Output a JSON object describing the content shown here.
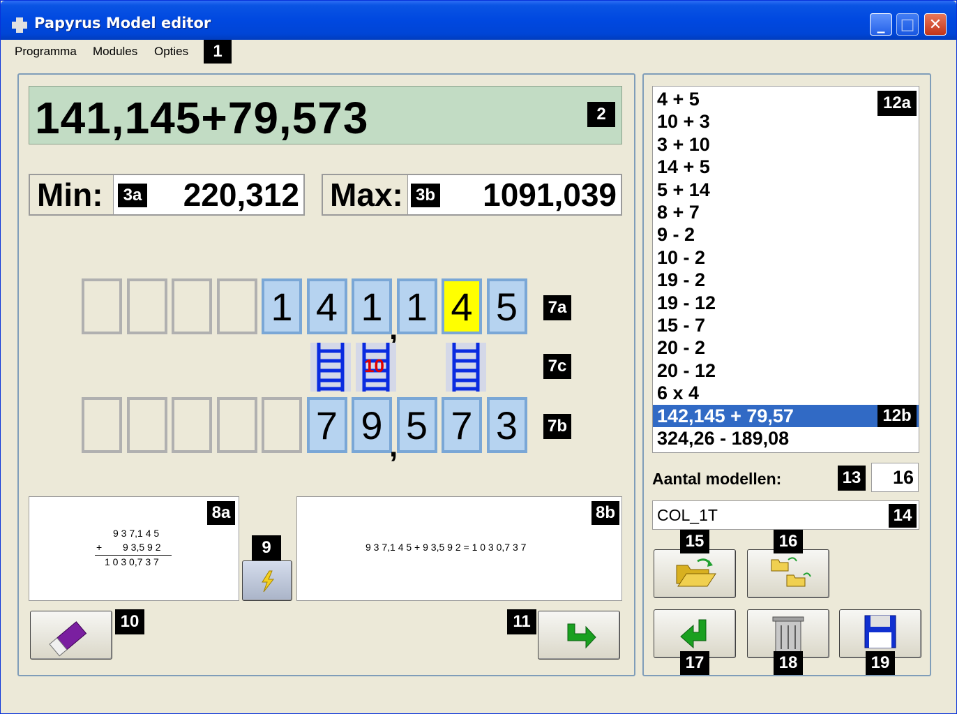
{
  "window": {
    "title": "Papyrus Model editor"
  },
  "menu": {
    "items": [
      "Programma",
      "Modules",
      "Opties"
    ]
  },
  "tags": {
    "t1": "1",
    "t2": "2",
    "t3a": "3a",
    "t3b": "3b",
    "t7a": "7a",
    "t7b": "7b",
    "t7c": "7c",
    "t8a": "8a",
    "t8b": "8b",
    "t9": "9",
    "t10": "10",
    "t11": "11",
    "t12a": "12a",
    "t12b": "12b",
    "t13": "13",
    "t14": "14",
    "t15": "15",
    "t16": "16",
    "t17": "17",
    "t18": "18",
    "t19": "19"
  },
  "expression": "141,145+79,573",
  "min": {
    "label": "Min:",
    "value": "220,312"
  },
  "max": {
    "label": "Max:",
    "value": "1091,039"
  },
  "row_a": {
    "digits": [
      "",
      "",
      "",
      "",
      "1",
      "4",
      "1",
      "1",
      "4",
      "5"
    ],
    "comma": ","
  },
  "row_b": {
    "digits": [
      "",
      "",
      "",
      "",
      "",
      "7",
      "9",
      "5",
      "7",
      "3"
    ],
    "comma": ","
  },
  "carry": {
    "label": "10"
  },
  "column_sum": {
    "line1": "9 3 7,1 4 5",
    "line2": "9 3,5 9 2",
    "plus": "+",
    "line3": "1 0 3 0,7 3 7"
  },
  "inline_sum": "9 3 7,1 4 5 + 9 3,5 9 2 = 1 0 3 0,7 3 7",
  "models": [
    "4 + 5",
    "10 + 3",
    "3 + 10",
    "14 + 5",
    "5 + 14",
    "8 + 7",
    "9 - 2",
    "10 - 2",
    "19 - 2",
    "19 - 12",
    "15 - 7",
    "20 - 2",
    "20 - 12",
    "6 x 4",
    "142,145 + 79,57",
    "324,26 - 189,08"
  ],
  "selected_model_index": 14,
  "aantal": {
    "label": "Aantal modellen:",
    "value": "16"
  },
  "code": "COL_1T",
  "colors": {
    "title_blue": "#0048e0",
    "expr_green": "#c2dcc4",
    "cell_blue": "#b6d3f0",
    "highlight": "#ffff00",
    "select": "#316ac5"
  }
}
